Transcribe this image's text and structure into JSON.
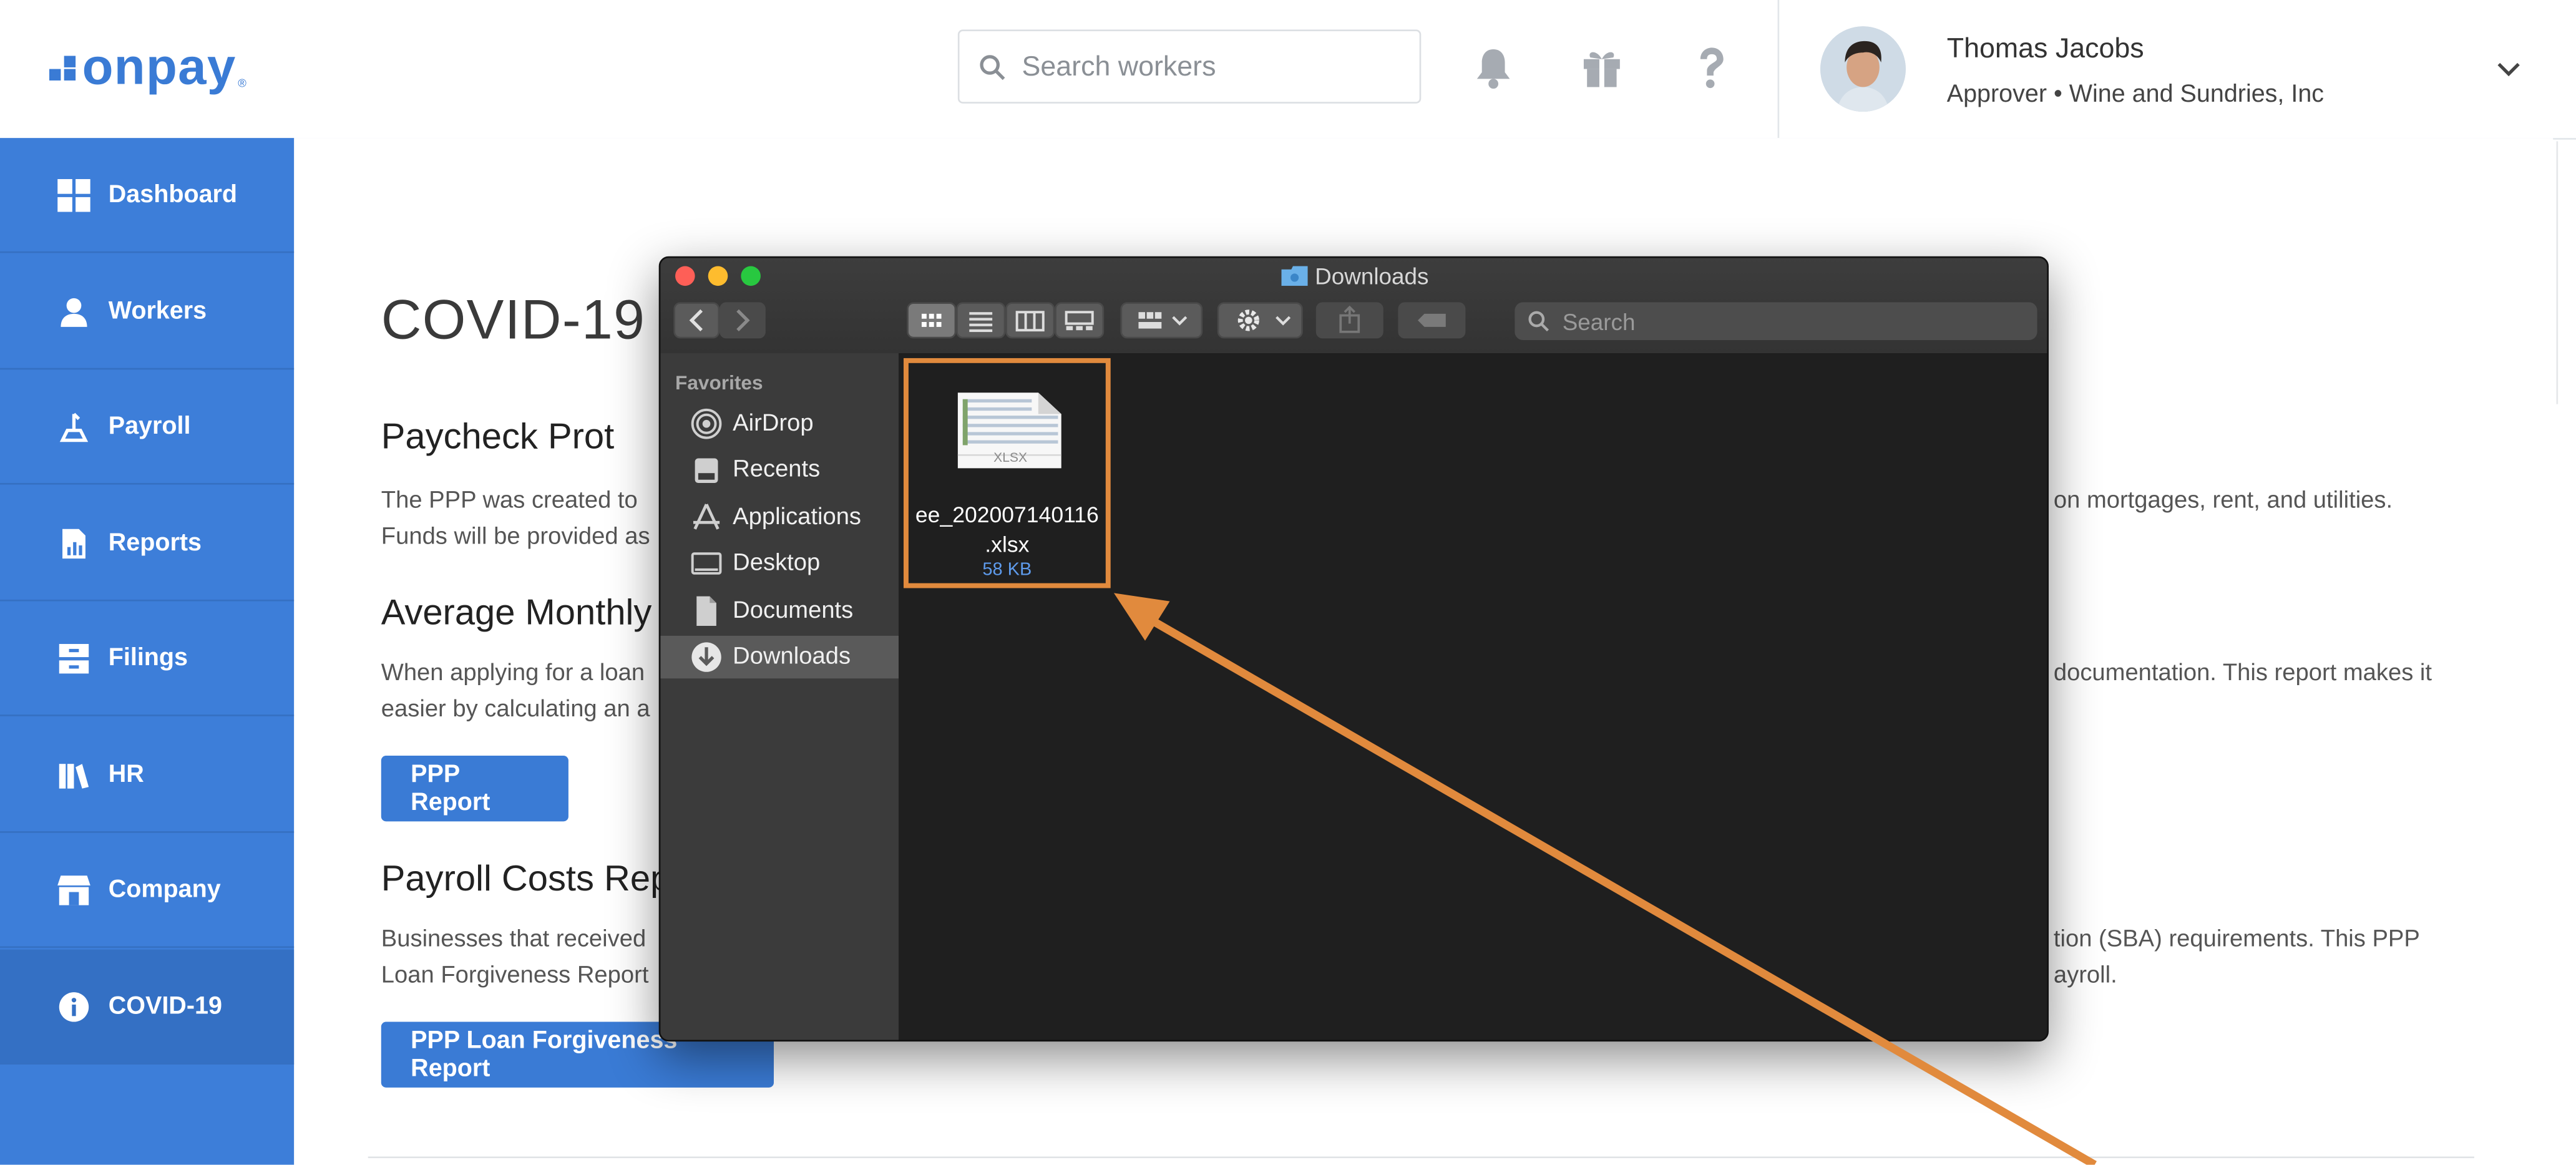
{
  "header": {
    "logo_text": "onpay",
    "logo_mark": "®",
    "search_placeholder": "Search workers",
    "user_name": "Thomas Jacobs",
    "user_role": "Approver • Wine and Sundries, Inc",
    "icons": [
      "bell-icon",
      "gift-icon",
      "help-icon",
      "chevron-down-icon"
    ]
  },
  "sidebar": {
    "items": [
      {
        "label": "Dashboard",
        "icon": "dashboard-icon"
      },
      {
        "label": "Workers",
        "icon": "workers-icon"
      },
      {
        "label": "Payroll",
        "icon": "payroll-icon"
      },
      {
        "label": "Reports",
        "icon": "reports-icon"
      },
      {
        "label": "Filings",
        "icon": "filings-icon"
      },
      {
        "label": "HR",
        "icon": "hr-icon"
      },
      {
        "label": "Company",
        "icon": "company-icon"
      },
      {
        "label": "COVID-19",
        "icon": "info-icon"
      }
    ],
    "active": "COVID-19"
  },
  "main": {
    "title": "COVID-19",
    "section1_heading": "Paycheck Prot",
    "section1_text_line1": "The PPP was created to",
    "section1_text_line2": "Funds will be provided as",
    "section1_text_right": "on mortgages, rent, and utilities.",
    "section2_heading": "Average Monthly",
    "section2_text_line1": "When applying for a loan",
    "section2_text_line2": "easier by calculating an a",
    "section2_text_right": "documentation. This report makes it",
    "ppp_report_button": "PPP Report",
    "section3_heading": "Payroll Costs Rep",
    "section3_text_line1": "Businesses that received",
    "section3_text_line2": "Loan Forgiveness Report",
    "section3_text_right1": "tion (SBA) requirements. This PPP",
    "section3_text_right2": "ayroll.",
    "forgiveness_button": "PPP Loan Forgiveness Report"
  },
  "finder": {
    "title": "Downloads",
    "search_placeholder": "Search",
    "favorites_label": "Favorites",
    "sidebar_items": [
      {
        "label": "AirDrop",
        "icon": "airdrop-icon"
      },
      {
        "label": "Recents",
        "icon": "recents-icon"
      },
      {
        "label": "Applications",
        "icon": "applications-icon"
      },
      {
        "label": "Desktop",
        "icon": "desktop-icon"
      },
      {
        "label": "Documents",
        "icon": "documents-icon"
      },
      {
        "label": "Downloads",
        "icon": "downloads-icon"
      }
    ],
    "selected": "Downloads",
    "file": {
      "name_line1": "ee_202007140116",
      "name_line2": ".xlsx",
      "size": "58 KB",
      "thumb_label": "XLSX"
    }
  },
  "colors": {
    "brand_blue": "#3a7bd5",
    "sidebar_blue": "#3d7ed9",
    "highlight_orange": "#e18a3d"
  }
}
